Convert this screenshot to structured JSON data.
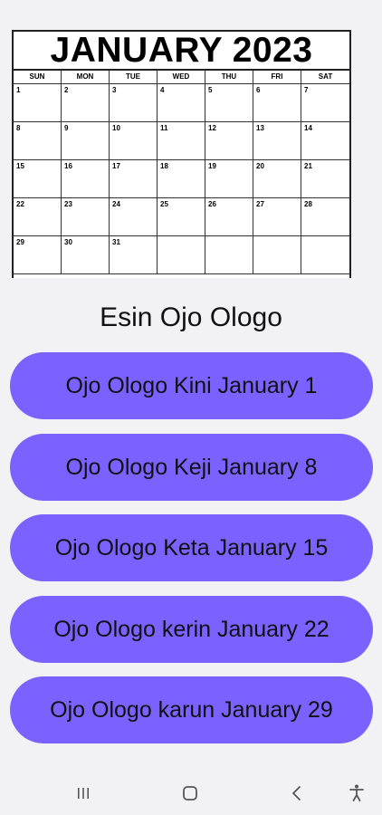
{
  "calendar": {
    "title": "JANUARY 2023",
    "weekdays": [
      "SUN",
      "MON",
      "TUE",
      "WED",
      "THU",
      "FRI",
      "SAT"
    ],
    "days": [
      "1",
      "2",
      "3",
      "4",
      "5",
      "6",
      "7",
      "8",
      "9",
      "10",
      "11",
      "12",
      "13",
      "14",
      "15",
      "16",
      "17",
      "18",
      "19",
      "20",
      "21",
      "22",
      "23",
      "24",
      "25",
      "26",
      "27",
      "28",
      "29",
      "30",
      "31",
      "",
      "",
      "",
      ""
    ]
  },
  "heading": "Esin Ojo Ologo",
  "buttons": [
    {
      "label": "Ojo Ologo Kini January 1"
    },
    {
      "label": "Ojo Ologo Keji January 8"
    },
    {
      "label": "Ojo Ologo Keta January 15"
    },
    {
      "label": "Ojo Ologo kerin January 22"
    },
    {
      "label": "Ojo Ologo karun January 29"
    }
  ],
  "nav": {
    "icons": [
      "recent-apps-icon",
      "home-icon",
      "back-icon",
      "accessibility-icon"
    ]
  },
  "colors": {
    "button": "#7b61ff",
    "background": "#f2f2f4"
  }
}
